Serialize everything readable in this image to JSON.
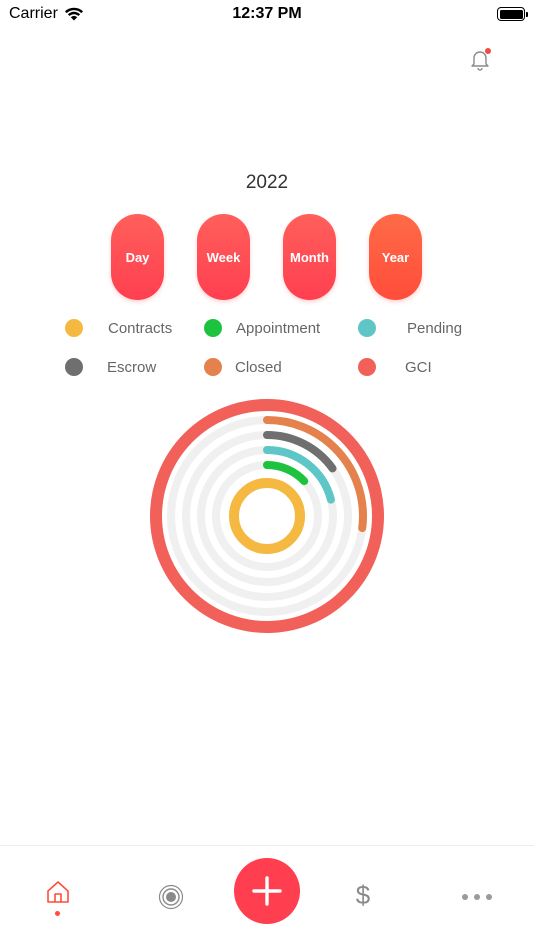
{
  "status_bar": {
    "carrier": "Carrier",
    "time": "12:37 PM"
  },
  "header": {
    "year": "2022"
  },
  "periods": [
    {
      "label": "Day",
      "active": false
    },
    {
      "label": "Week",
      "active": false
    },
    {
      "label": "Month",
      "active": false
    },
    {
      "label": "Year",
      "active": true
    }
  ],
  "legend": [
    {
      "label": "Contracts",
      "color": "#f5b942"
    },
    {
      "label": "Appointment",
      "color": "#1dc23f"
    },
    {
      "label": "Pending",
      "color": "#5ec6c6"
    },
    {
      "label": "Escrow",
      "color": "#6f6f6f"
    },
    {
      "label": "Closed",
      "color": "#e5814d"
    },
    {
      "label": "GCI",
      "color": "#f2605a"
    }
  ],
  "rings_chart": {
    "type": "radial-progress",
    "track_color": "#f0f0f0",
    "rings": [
      {
        "label": "GCI",
        "color": "#f2605a",
        "fraction": 1.0
      },
      {
        "label": "Closed",
        "color": "#e5814d",
        "fraction": 0.27
      },
      {
        "label": "Escrow",
        "color": "#6f6f6f",
        "fraction": 0.15
      },
      {
        "label": "Pending",
        "color": "#5ec6c6",
        "fraction": 0.21
      },
      {
        "label": "Appointment",
        "color": "#1dc23f",
        "fraction": 0.13
      },
      {
        "label": "Contracts",
        "color": "#f5b942",
        "fraction": 1.0
      }
    ]
  },
  "tabbar": {
    "items": [
      {
        "icon": "home-icon"
      },
      {
        "icon": "target-icon"
      },
      {
        "icon": "plus-icon"
      },
      {
        "icon": "dollar-icon",
        "glyph": "$"
      },
      {
        "icon": "more-icon"
      }
    ],
    "accent": "#ff3f4f"
  }
}
